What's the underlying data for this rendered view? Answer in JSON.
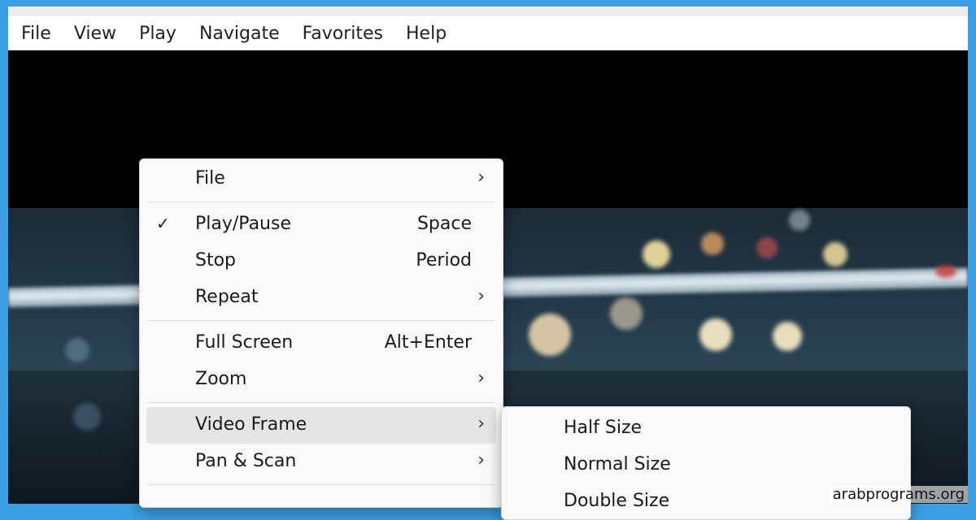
{
  "menubar": {
    "items": [
      {
        "label": "File"
      },
      {
        "label": "View"
      },
      {
        "label": "Play"
      },
      {
        "label": "Navigate"
      },
      {
        "label": "Favorites"
      },
      {
        "label": "Help"
      }
    ]
  },
  "context_menu": {
    "items": {
      "file": {
        "label": "File",
        "arrow": "›"
      },
      "play_pause": {
        "label": "Play/Pause",
        "shortcut": "Space",
        "check": "✓"
      },
      "stop": {
        "label": "Stop",
        "shortcut": "Period"
      },
      "repeat": {
        "label": "Repeat",
        "arrow": "›"
      },
      "full_screen": {
        "label": "Full Screen",
        "shortcut": "Alt+Enter"
      },
      "zoom": {
        "label": "Zoom",
        "arrow": "›"
      },
      "video_frame": {
        "label": "Video Frame",
        "arrow": "›"
      },
      "pan_scan": {
        "label": "Pan & Scan",
        "arrow": "›"
      }
    }
  },
  "submenu": {
    "items": [
      {
        "label": "Half Size"
      },
      {
        "label": "Normal Size"
      },
      {
        "label": "Double Size"
      }
    ]
  },
  "watermark": "arabprograms.org",
  "colors": {
    "frame_border": "#3aa0e3",
    "menu_bg": "#f9f9f9",
    "selected_bg": "#e5e5e5"
  }
}
